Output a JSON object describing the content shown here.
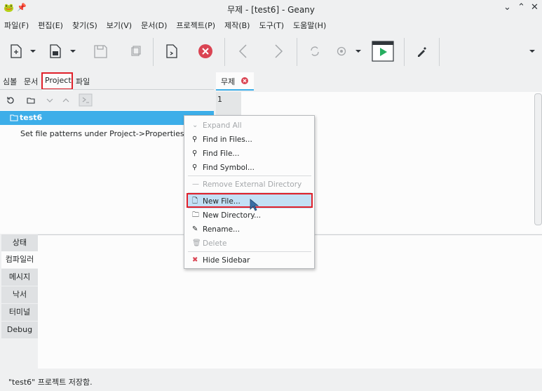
{
  "window": {
    "title": "무제 - [test6] - Geany",
    "controls": [
      "⌄",
      "⌃",
      "✕"
    ]
  },
  "menu": [
    "파일(F)",
    "편집(E)",
    "찾기(S)",
    "보기(V)",
    "문서(D)",
    "프로젝트(P)",
    "제작(B)",
    "도구(T)",
    "도움말(H)"
  ],
  "sidebar": {
    "tabs": [
      "심볼",
      "문서",
      "Project",
      "파일"
    ],
    "tree": {
      "project_name": "test6",
      "hint": "Set file patterns under Project->Properties"
    }
  },
  "editor": {
    "tab_label": "무제",
    "line_number": "1"
  },
  "message_tabs": [
    "상태",
    "컴파일러",
    "메시지",
    "낙서",
    "터미널",
    "Debug"
  ],
  "statusbar": {
    "text": "\"test6\" 프로젝트 저장함."
  },
  "context_menu": {
    "items": [
      {
        "label": "Expand All",
        "icon": "⌄"
      },
      {
        "label": "Find in Files...",
        "icon": "⚲"
      },
      {
        "label": "Find File...",
        "icon": "⚲"
      },
      {
        "label": "Find Symbol...",
        "icon": "⚲"
      },
      {
        "label": "Remove External Directory",
        "icon": "—"
      },
      {
        "label": "New File...",
        "icon": "🗋"
      },
      {
        "label": "New Directory...",
        "icon": "🗀"
      },
      {
        "label": "Rename...",
        "icon": "✎"
      },
      {
        "label": "Delete",
        "icon": "🗑"
      },
      {
        "label": "Hide Sidebar",
        "icon": "✖"
      }
    ]
  },
  "colors": {
    "selection": "#3daee9",
    "highlight_box": "#e0202a",
    "menu_hover": "#c2e0f5",
    "stop_icon": "#da4453",
    "run_icon": "#27ae60"
  }
}
